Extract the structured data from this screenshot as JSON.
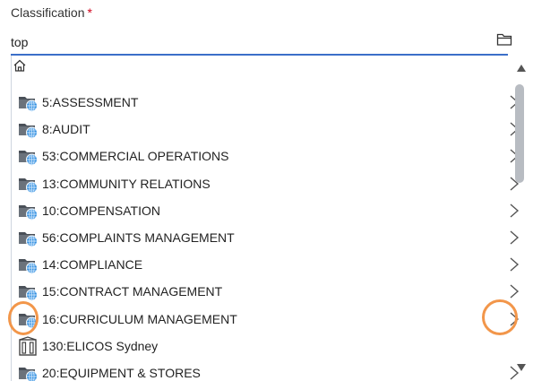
{
  "field": {
    "label": "Classification",
    "required_marker": "*",
    "value": "top"
  },
  "icons": {
    "folder_button": "folder-icon",
    "home": "home-icon",
    "item_globe_folder": "globe-folder-icon",
    "item_building": "building-icon",
    "row_chevron": "chevron-right-icon"
  },
  "list": {
    "items": [
      {
        "label": "5:ASSESSMENT",
        "icon": "globe-folder-icon",
        "has_children": true
      },
      {
        "label": "8:AUDIT",
        "icon": "globe-folder-icon",
        "has_children": true
      },
      {
        "label": "53:COMMERCIAL OPERATIONS",
        "icon": "globe-folder-icon",
        "has_children": true
      },
      {
        "label": "13:COMMUNITY RELATIONS",
        "icon": "globe-folder-icon",
        "has_children": true
      },
      {
        "label": "10:COMPENSATION",
        "icon": "globe-folder-icon",
        "has_children": true
      },
      {
        "label": "56:COMPLAINTS MANAGEMENT",
        "icon": "globe-folder-icon",
        "has_children": true
      },
      {
        "label": "14:COMPLIANCE",
        "icon": "globe-folder-icon",
        "has_children": true
      },
      {
        "label": "15:CONTRACT MANAGEMENT",
        "icon": "globe-folder-icon",
        "has_children": true
      },
      {
        "label": "16:CURRICULUM MANAGEMENT",
        "icon": "globe-folder-icon",
        "has_children": true,
        "highlighted": true
      },
      {
        "label": "130:ELICOS Sydney",
        "icon": "building-icon",
        "has_children": false
      },
      {
        "label": "20:EQUIPMENT & STORES",
        "icon": "globe-folder-icon",
        "has_children": true
      }
    ]
  },
  "colors": {
    "accent_underline": "#3b6fc9",
    "required": "#d0021b",
    "highlight_ring": "#f2964a",
    "scroll_thumb": "#b8bcc2"
  }
}
